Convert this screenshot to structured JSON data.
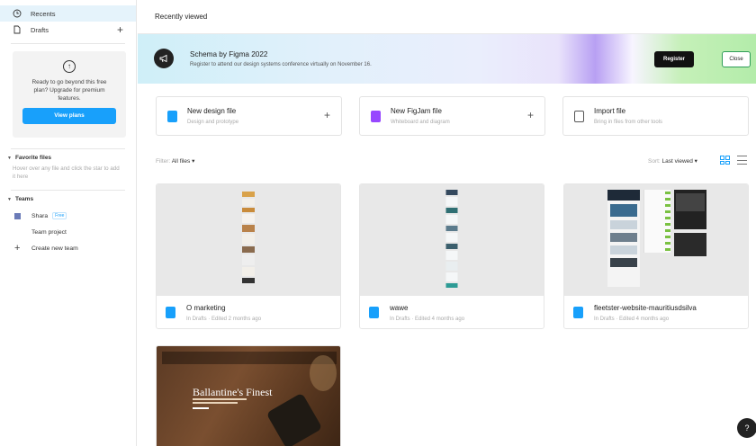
{
  "sidebar": {
    "nav": [
      {
        "label": "Recents",
        "icon": "clock-icon"
      },
      {
        "label": "Drafts",
        "icon": "file-icon"
      }
    ],
    "drafts_add": "+",
    "upgrade": {
      "text": "Ready to go beyond this free plan? Upgrade for premium features.",
      "button": "View plans",
      "icon": "arrow-up-circle-icon"
    },
    "favorites": {
      "label": "Favorite files",
      "hint": "Hover over any file and click the star to add it here"
    },
    "teams": {
      "label": "Teams",
      "team_name": "Shara",
      "team_badge": "Free",
      "project": "Team project",
      "create": "Create new team"
    }
  },
  "header": {
    "title": "Recently viewed"
  },
  "banner": {
    "title": "Schema by Figma 2022",
    "subtitle": "Register to attend our design systems conference virtually on November 16.",
    "register": "Register",
    "close": "Close"
  },
  "create_cards": [
    {
      "title": "New design file",
      "subtitle": "Design and prototype",
      "icon": "design-file-icon",
      "color": "#18a0fb",
      "action": "+"
    },
    {
      "title": "New FigJam file",
      "subtitle": "Whiteboard and diagram",
      "icon": "figjam-file-icon",
      "color": "#9747ff",
      "action": "+"
    },
    {
      "title": "Import file",
      "subtitle": "Bring in files from other tools",
      "icon": "import-icon",
      "color": "#ffffff",
      "action": ""
    }
  ],
  "filter": {
    "label": "Filter:",
    "value": "All files ▾"
  },
  "sort": {
    "label": "Sort:",
    "value": "Last viewed ▾"
  },
  "files": [
    {
      "name": "O marketing",
      "meta": "In Drafts · Edited 2 months ago"
    },
    {
      "name": "wawe",
      "meta": "In Drafts · Edited 4 months ago"
    },
    {
      "name": "fleetster-website-mauritiusdsilva",
      "meta": "In Drafts · Edited 4 months ago"
    },
    {
      "name": "",
      "meta": "",
      "thumb_text": "Ballantine's Finest"
    }
  ],
  "help": "?"
}
